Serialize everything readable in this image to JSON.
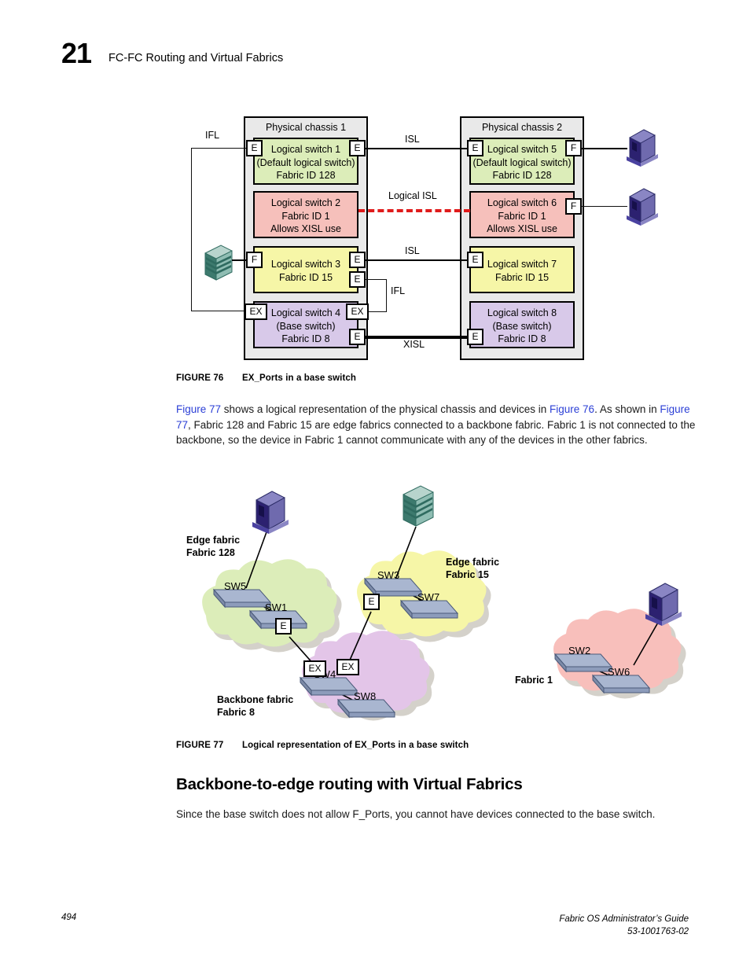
{
  "header": {
    "chapter_number": "21",
    "chapter_title": "FC-FC Routing and Virtual Fabrics"
  },
  "footer": {
    "page_number": "494",
    "guide_title": "Fabric OS Administrator’s Guide",
    "doc_number": "53-1001763-02"
  },
  "figure76": {
    "caption_id": "FIGURE 76",
    "caption_text": "EX_Ports in a base switch",
    "chassis": [
      {
        "label": "Physical chassis 1"
      },
      {
        "label": "Physical chassis 2"
      }
    ],
    "switches": [
      {
        "id": "ls1",
        "name": "Logical switch 1",
        "line2": "(Default logical switch)",
        "line3": "Fabric ID 128",
        "color": "#dcedb9"
      },
      {
        "id": "ls2",
        "name": "Logical switch 2",
        "line2": "Fabric ID 1",
        "line3": "Allows XISL use",
        "color": "#f6c0bb"
      },
      {
        "id": "ls3",
        "name": "Logical switch 3",
        "line2": "Fabric ID 15",
        "line3": "",
        "color": "#f6f6a7"
      },
      {
        "id": "ls4",
        "name": "Logical switch 4",
        "line2": "(Base switch)",
        "line3": "Fabric ID 8",
        "color": "#d8c9e9"
      },
      {
        "id": "ls5",
        "name": "Logical switch 5",
        "line2": "(Default logical switch)",
        "line3": "Fabric ID 128",
        "color": "#dcedb9"
      },
      {
        "id": "ls6",
        "name": "Logical switch 6",
        "line2": "Fabric ID 1",
        "line3": "Allows XISL use",
        "color": "#f6c0bb"
      },
      {
        "id": "ls7",
        "name": "Logical switch 7",
        "line2": "Fabric ID 15",
        "line3": "",
        "color": "#f6f6a7"
      },
      {
        "id": "ls8",
        "name": "Logical switch 8",
        "line2": "(Base switch)",
        "line3": "Fabric ID 8",
        "color": "#d8c9e9"
      }
    ],
    "ports": {
      "c1_ls1_left": "E",
      "c1_ls1_right": "E",
      "c1_ls3_left": "F",
      "c1_ls3_right": "E",
      "c1_ls3_right2": "E",
      "c1_ls4_left": "EX",
      "c1_ls4_right": "EX",
      "c1_ls4_right2": "E",
      "c2_ls5_left": "E",
      "c2_ls5_right": "F",
      "c2_ls6_right": "F",
      "c2_ls7_left": "E",
      "c2_ls8_left": "E"
    },
    "link_labels": {
      "ifl_left": "IFL",
      "isl_top": "ISL",
      "logical_isl": "Logical ISL",
      "isl_mid": "ISL",
      "ifl_mid": "IFL",
      "xisl": "XISL"
    },
    "colors": {
      "logical_isl_line": "#e01b1b",
      "chassis_fill": "#e9e9e9"
    }
  },
  "body_paragraph": {
    "part1": "Figure 77",
    "part2": " shows a logical representation of the physical chassis and devices in ",
    "part3": "Figure 76",
    "part4": ". As shown in ",
    "part5": "Figure 77",
    "part6": ", Fabric 128 and Fabric 15 are edge fabrics connected to a backbone fabric. Fabric 1 is not connected to the backbone, so the device in Fabric 1 cannot communicate with any of the devices in the other fabrics."
  },
  "figure77": {
    "caption_id": "FIGURE 77",
    "caption_text": "Logical representation of EX_Ports in a base switch",
    "fabrics": [
      {
        "id": "f128",
        "label_line1": "Edge fabric",
        "label_line2": "Fabric 128",
        "color": "#dcedb9",
        "switches": [
          "SW5",
          "SW1"
        ]
      },
      {
        "id": "f15",
        "label_line1": "Edge fabric",
        "label_line2": "Fabric 15",
        "color": "#f6f6a7",
        "switches": [
          "SW3",
          "SW7"
        ]
      },
      {
        "id": "f8",
        "label_line1": "Backbone fabric",
        "label_line2": "Fabric 8",
        "color": "#e3c5e8",
        "switches": [
          "SW4",
          "SW8"
        ]
      },
      {
        "id": "f1",
        "label_line1": "Fabric 1",
        "label_line2": "",
        "color": "#f8bfbb",
        "switches": [
          "SW2",
          "SW6"
        ]
      }
    ],
    "ports": {
      "f128_e": "E",
      "f15_e": "E",
      "f8_ex_left": "EX",
      "f8_ex_right": "EX"
    }
  },
  "section": {
    "heading": "Backbone-to-edge routing with Virtual Fabrics",
    "paragraph": "Since the base switch does not allow F_Ports, you cannot have devices connected to the base switch."
  }
}
